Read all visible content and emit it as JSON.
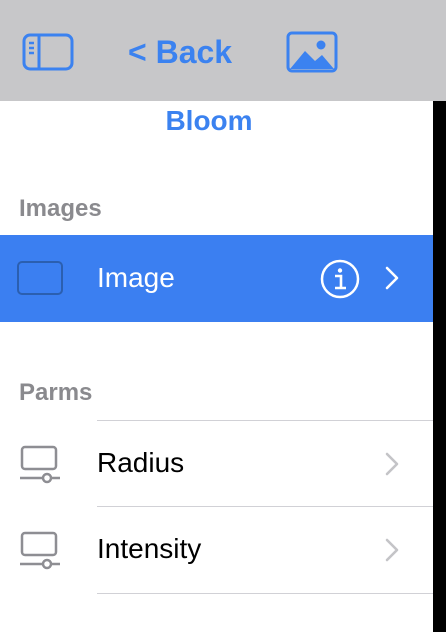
{
  "toolbar": {
    "back_label": "< Back"
  },
  "title": "Bloom",
  "sections": {
    "images": {
      "header": "Images",
      "items": [
        {
          "label": "Image",
          "selected": true
        }
      ]
    },
    "parms": {
      "header": "Parms",
      "items": [
        {
          "label": "Radius"
        },
        {
          "label": "Intensity"
        }
      ]
    }
  },
  "colors": {
    "accent": "#3b82f0",
    "selected_row": "#3b7ff1",
    "toolbar_bg": "#c7c7c9",
    "section_header": "#8a8a8e"
  }
}
